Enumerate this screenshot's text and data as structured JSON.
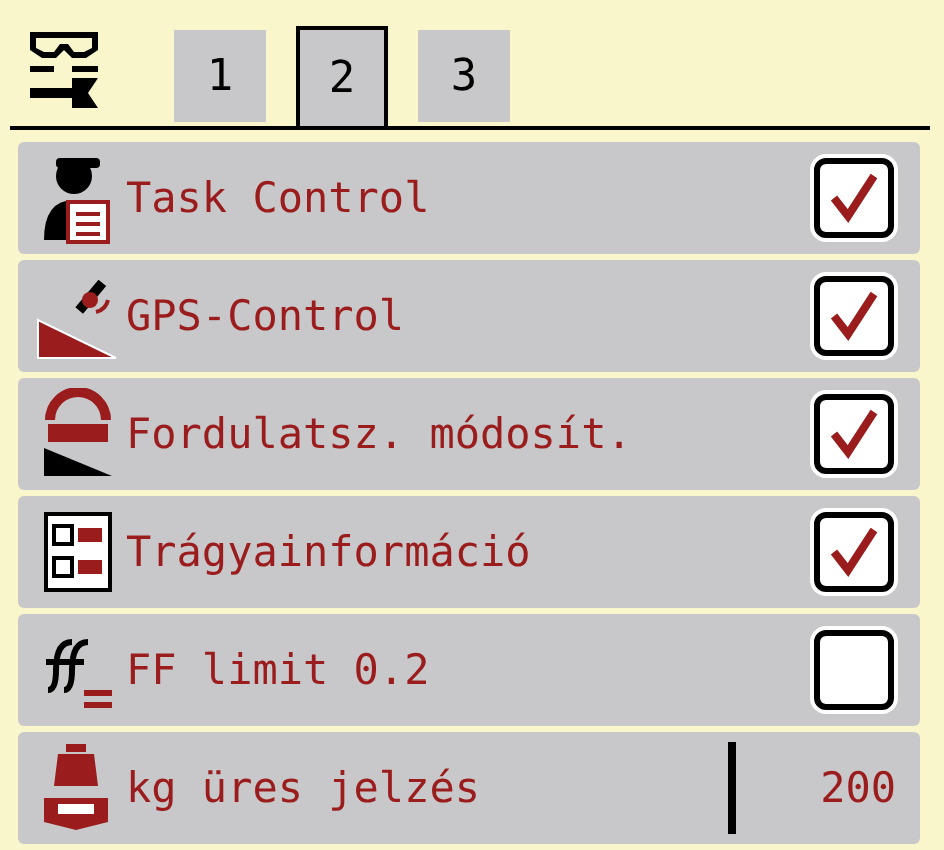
{
  "tabs": [
    {
      "label": "1",
      "selected": false
    },
    {
      "label": "2",
      "selected": true
    },
    {
      "label": "3",
      "selected": false
    }
  ],
  "rows": [
    {
      "kind": "checkbox",
      "label": "Task Control",
      "checked": true
    },
    {
      "kind": "checkbox",
      "label": "GPS-Control",
      "checked": true
    },
    {
      "kind": "checkbox",
      "label": "Fordulatsz. módosít.",
      "checked": true
    },
    {
      "kind": "checkbox",
      "label": "Trágyainformáció",
      "checked": true
    },
    {
      "kind": "checkbox",
      "label": "FF limit 0.2",
      "checked": false
    },
    {
      "kind": "value",
      "label": "kg üres jelzés",
      "value": "200"
    }
  ]
}
